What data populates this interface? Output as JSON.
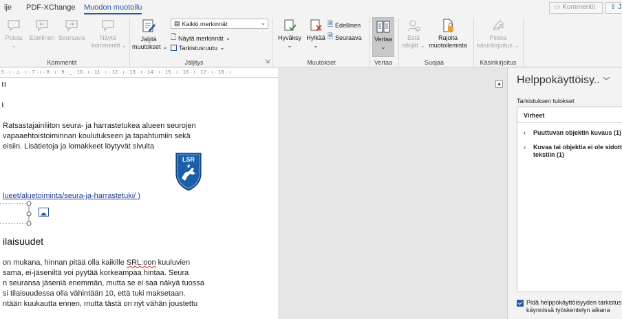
{
  "menu": {
    "tabs": [
      {
        "label": "ije",
        "active": false
      },
      {
        "label": "PDF-XChange",
        "active": false
      },
      {
        "label": "Muodon muotoilu",
        "active": true
      }
    ],
    "comments_button": "Kommentit",
    "share_button": "J"
  },
  "ribbon": {
    "kommentit": {
      "poista": "Poista",
      "edellinen": "Edellinen",
      "seuraava": "Seuraava",
      "nayta_line1": "Näytä",
      "nayta_line2": "kommentit",
      "group_label": "Kommentit"
    },
    "jaljitys": {
      "jaljita_line1": "Jäljitä",
      "jaljita_line2": "muutokset",
      "markup_dropdown": "Kaikki merkinnät",
      "show_markup": "Näytä merkinnät",
      "review_pane": "Tarkistusruutu",
      "group_label": "Jäljitys"
    },
    "muutokset": {
      "hyvaksy": "Hyväksy",
      "hylkaa": "Hylkää",
      "edellinen": "Edellinen",
      "seuraava": "Seuraava",
      "group_label": "Muutokset"
    },
    "vertaa": {
      "button": "Vertaa",
      "group_label": "Vertaa"
    },
    "suojaa": {
      "esta_line1": "Estä",
      "esta_line2": "tekijät",
      "rajoita_line1": "Rajoita",
      "rajoita_line2": "muotoilemista",
      "group_label": "Suojaa"
    },
    "kasinkirjoitus": {
      "piilota_line1": "Piilota",
      "piilota_line2": "käsinkirjoitus",
      "group_label": "Käsinkirjoitus"
    }
  },
  "ruler": {
    "text": "5 · ı · △ · ı · 7 · ı · 8 · ı · 9 · ˽ · 10 · ı · 11 · ı · 12 · ı · 13 · ı · 14 · ı · 15 · ı · 16 · ı · 17 · ı · 18 · ı"
  },
  "document": {
    "fragment1": "ıı",
    "fragment2": "ı",
    "para1": [
      "Ratsastajainliiton seura- ja harrastetukea alueen seurojen",
      "vapaaehtoistoiminnan koulutukseen ja tapahtumiin sekä",
      "eisiin. Lisätietoja ja lomakkeet löytyvät sivulta"
    ],
    "logo_text": "LSR",
    "link": "lueet/aluetoiminta/seura-ja-harrastetuki/ )",
    "heading": "ilaisuudet",
    "para2_line1_pre": "on mukana, hinnan pitää olla kaikille ",
    "para2_line1_err": "SRL:oon",
    "para2_line1_post": " kuuluvien",
    "para2_rest": [
      "sama, ei-jäseniltä voi pyytää korkeampaa hintaa. Seura",
      "n seuransa jäseniä enemmän, mutta se ei saa näkyä tuossa",
      "si tilaisuudessa olla vähintään 10, että tuki maksetaan.",
      "ntään kuukautta ennen, mutta tästä on nyt vähän joustettu"
    ]
  },
  "accessibility_pane": {
    "title": "Helppokäyttöisy..",
    "subtitle": "Tarkistuksen tulokset",
    "errors_header": "Virheet",
    "issue1": "Puuttuvan objektin kuvaus (1)",
    "issue2_line1": "Kuvaa tai objektia ei ole sidott",
    "issue2_line2": "tekstiin (1)",
    "checkbox_line1": "Pidä helppokäyttöisyyden tarkistus",
    "checkbox_line2": "käynnissä työskentelyn aikana",
    "checkbox_checked": true
  }
}
